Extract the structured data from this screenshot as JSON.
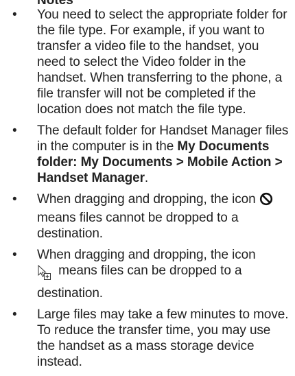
{
  "heading_fragment": "Notes",
  "bullet_glyph": "•",
  "items": [
    {
      "text": "You need to select the appropriate folder for the file type. For example, if you want to transfer a video file to the handset, you need to select the Video folder in the handset. When transferring to the phone, a file transfer will not be completed if the location does not match the file type."
    },
    {
      "text_before": "The default folder for Handset Manager files in the computer is in the ",
      "bold": "My Documents folder: My Documents > Mobile Action > Handset Manager",
      "text_after": "."
    },
    {
      "text_before": "When dragging and dropping, the icon ",
      "icon": "no-drop-icon",
      "text_after": " means files cannot be dropped to a destination."
    },
    {
      "text_before": "When dragging and dropping, the icon ",
      "icon": "drag-copy-cursor-icon",
      "text_after": " means files can be dropped to a destination."
    },
    {
      "text": "Large files may take a few minutes to move. To reduce the transfer time, you may use the handset as a mass storage device instead."
    }
  ]
}
